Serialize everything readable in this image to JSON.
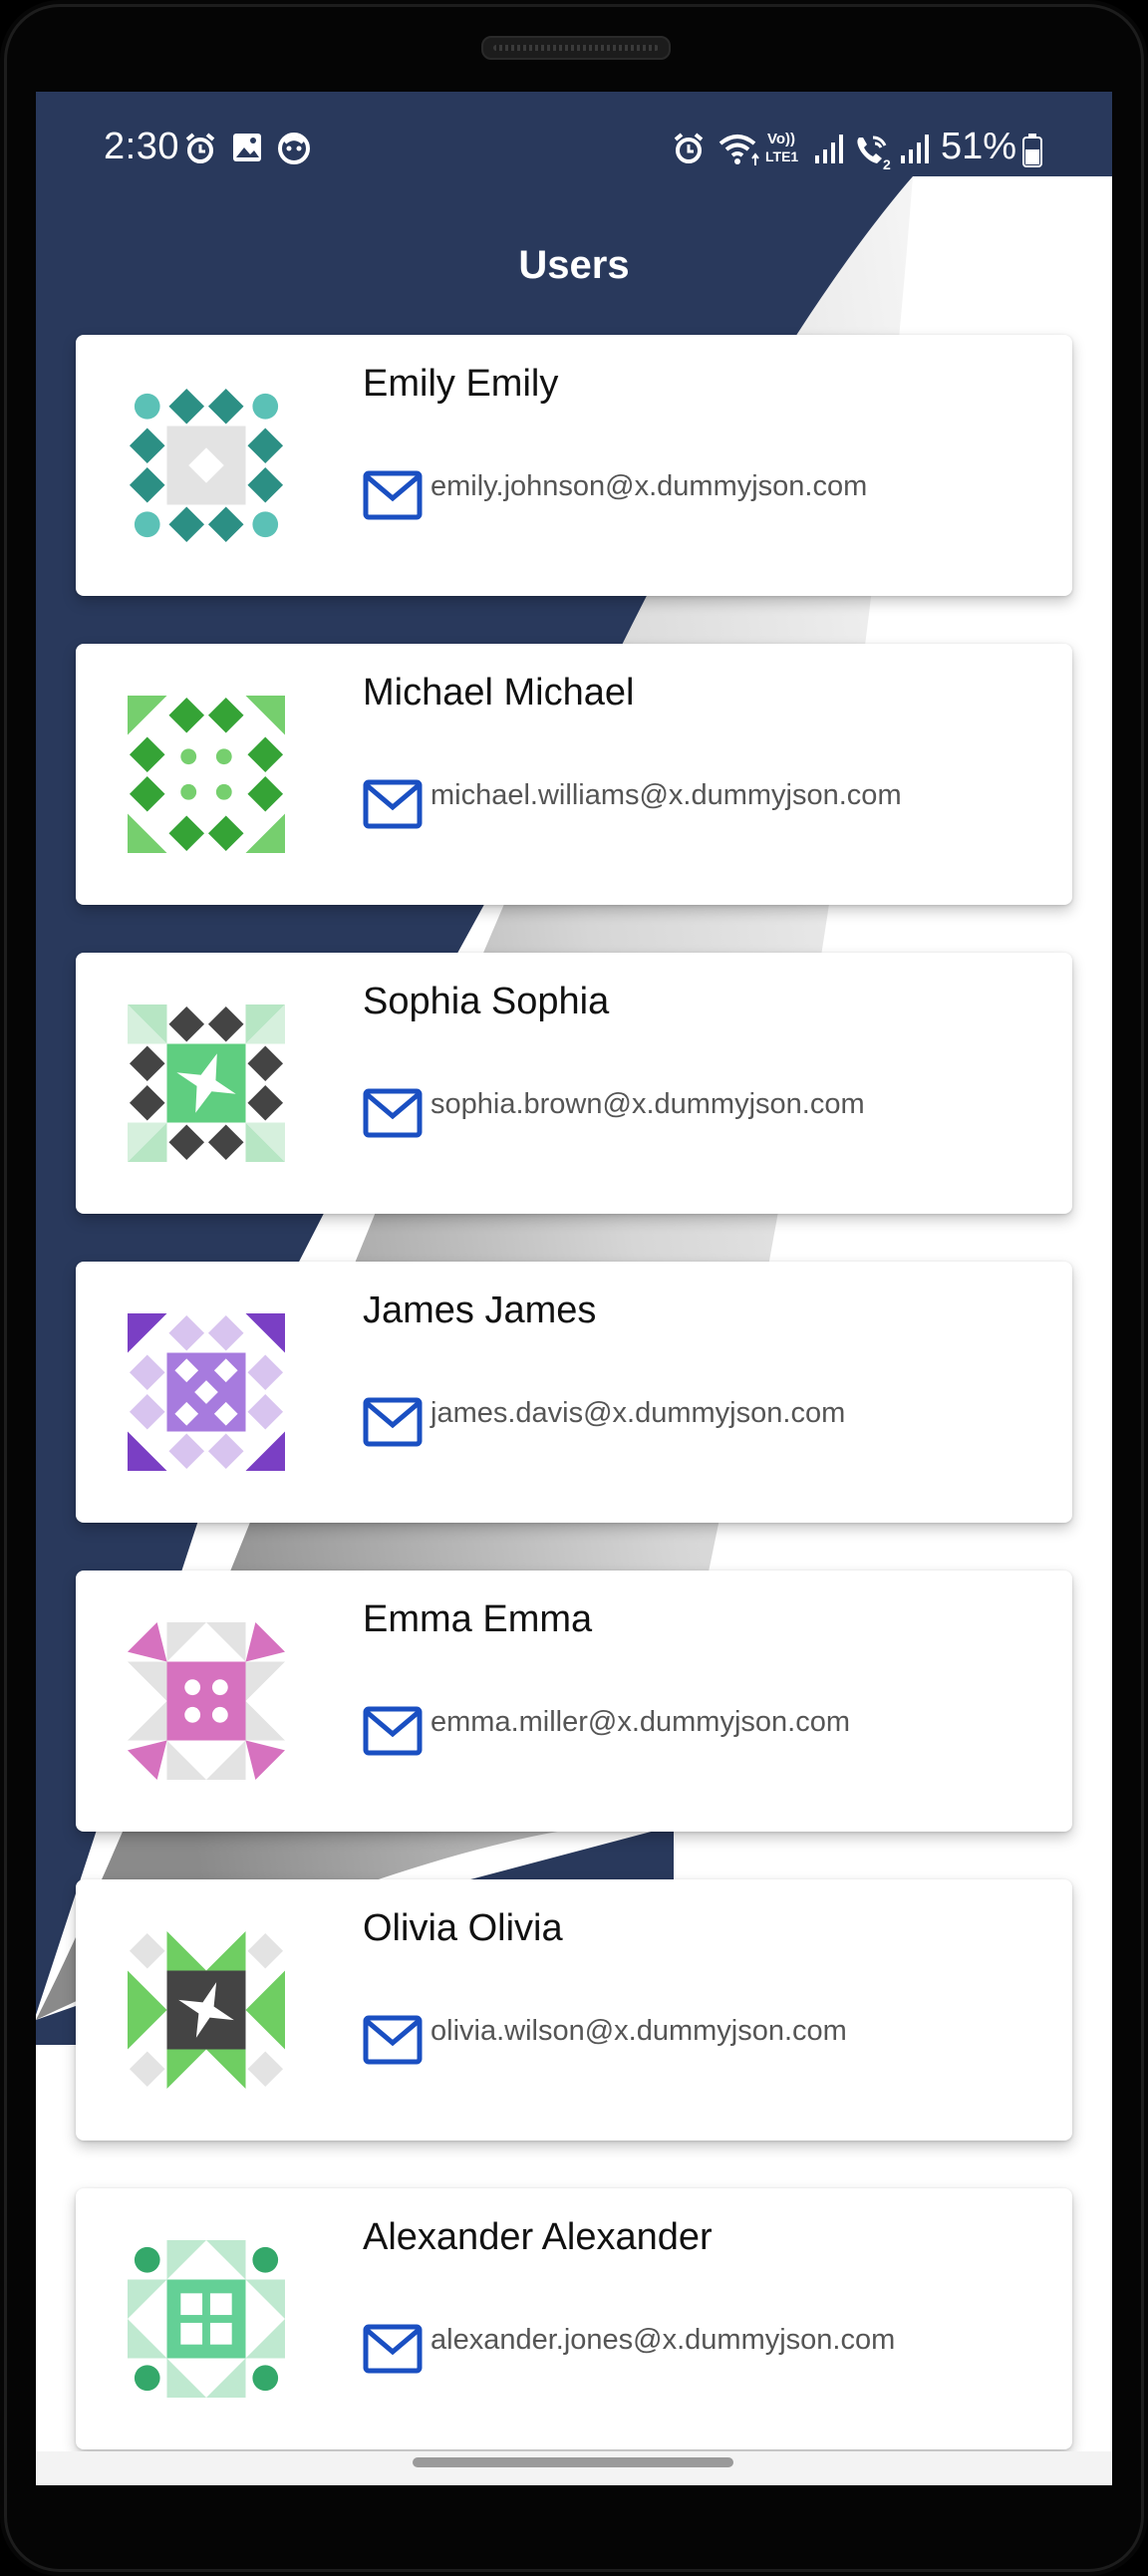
{
  "status_bar": {
    "time": "2:30",
    "battery": "51%",
    "left_icons": [
      "alarm-icon",
      "gallery-icon",
      "face-icon"
    ],
    "right_icons": [
      "alarm-icon",
      "wifi-icon",
      "volte-icon",
      "signal-icon",
      "wifi-call-icon",
      "signal-icon"
    ]
  },
  "header": {
    "title": "Users"
  },
  "colors": {
    "navy": "#29395c",
    "mail_icon": "#1a4fc2",
    "name_text": "#111111",
    "email_text": "#555555"
  },
  "users": [
    {
      "name": "Emily Emily",
      "email": "emily.johnson@x.dummyjson.com",
      "avatar": "teal-identicon"
    },
    {
      "name": "Michael Michael",
      "email": "michael.williams@x.dummyjson.com",
      "avatar": "green-identicon"
    },
    {
      "name": "Sophia Sophia",
      "email": "sophia.brown@x.dummyjson.com",
      "avatar": "dark-green-identicon"
    },
    {
      "name": "James James",
      "email": "james.davis@x.dummyjson.com",
      "avatar": "purple-identicon"
    },
    {
      "name": "Emma Emma",
      "email": "emma.miller@x.dummyjson.com",
      "avatar": "pink-identicon"
    },
    {
      "name": "Olivia Olivia",
      "email": "olivia.wilson@x.dummyjson.com",
      "avatar": "green-dark-identicon"
    },
    {
      "name": "Alexander Alexander",
      "email": "alexander.jones@x.dummyjson.com",
      "avatar": "mint-identicon"
    }
  ]
}
